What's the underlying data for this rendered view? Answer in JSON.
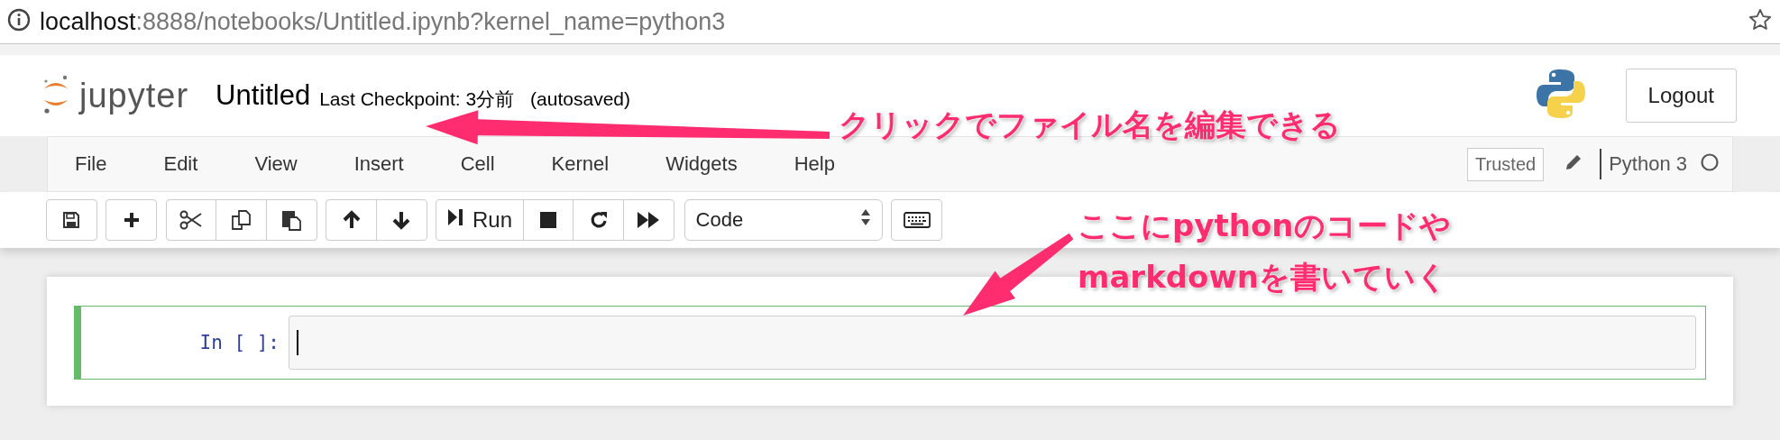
{
  "browser": {
    "url_host": "localhost",
    "url_rest": ":8888/notebooks/Untitled.ipynb?kernel_name=python3"
  },
  "header": {
    "logo_text": "jupyter",
    "title": "Untitled",
    "checkpoint": "Last Checkpoint: 3分前",
    "autosave": "(autosaved)",
    "logout": "Logout"
  },
  "menu": [
    "File",
    "Edit",
    "View",
    "Insert",
    "Cell",
    "Kernel",
    "Widgets",
    "Help"
  ],
  "status": {
    "trusted": "Trusted",
    "kernel": "Python 3"
  },
  "toolbar": {
    "run": "Run",
    "cell_type": "Code"
  },
  "cell": {
    "prompt": "In [ ]:"
  },
  "annotations": [
    {
      "lines": [
        "クリックでファイル名を編集できる"
      ]
    },
    {
      "lines": [
        "ここにpythonのコードや",
        "markdownを書いていく"
      ]
    }
  ]
}
